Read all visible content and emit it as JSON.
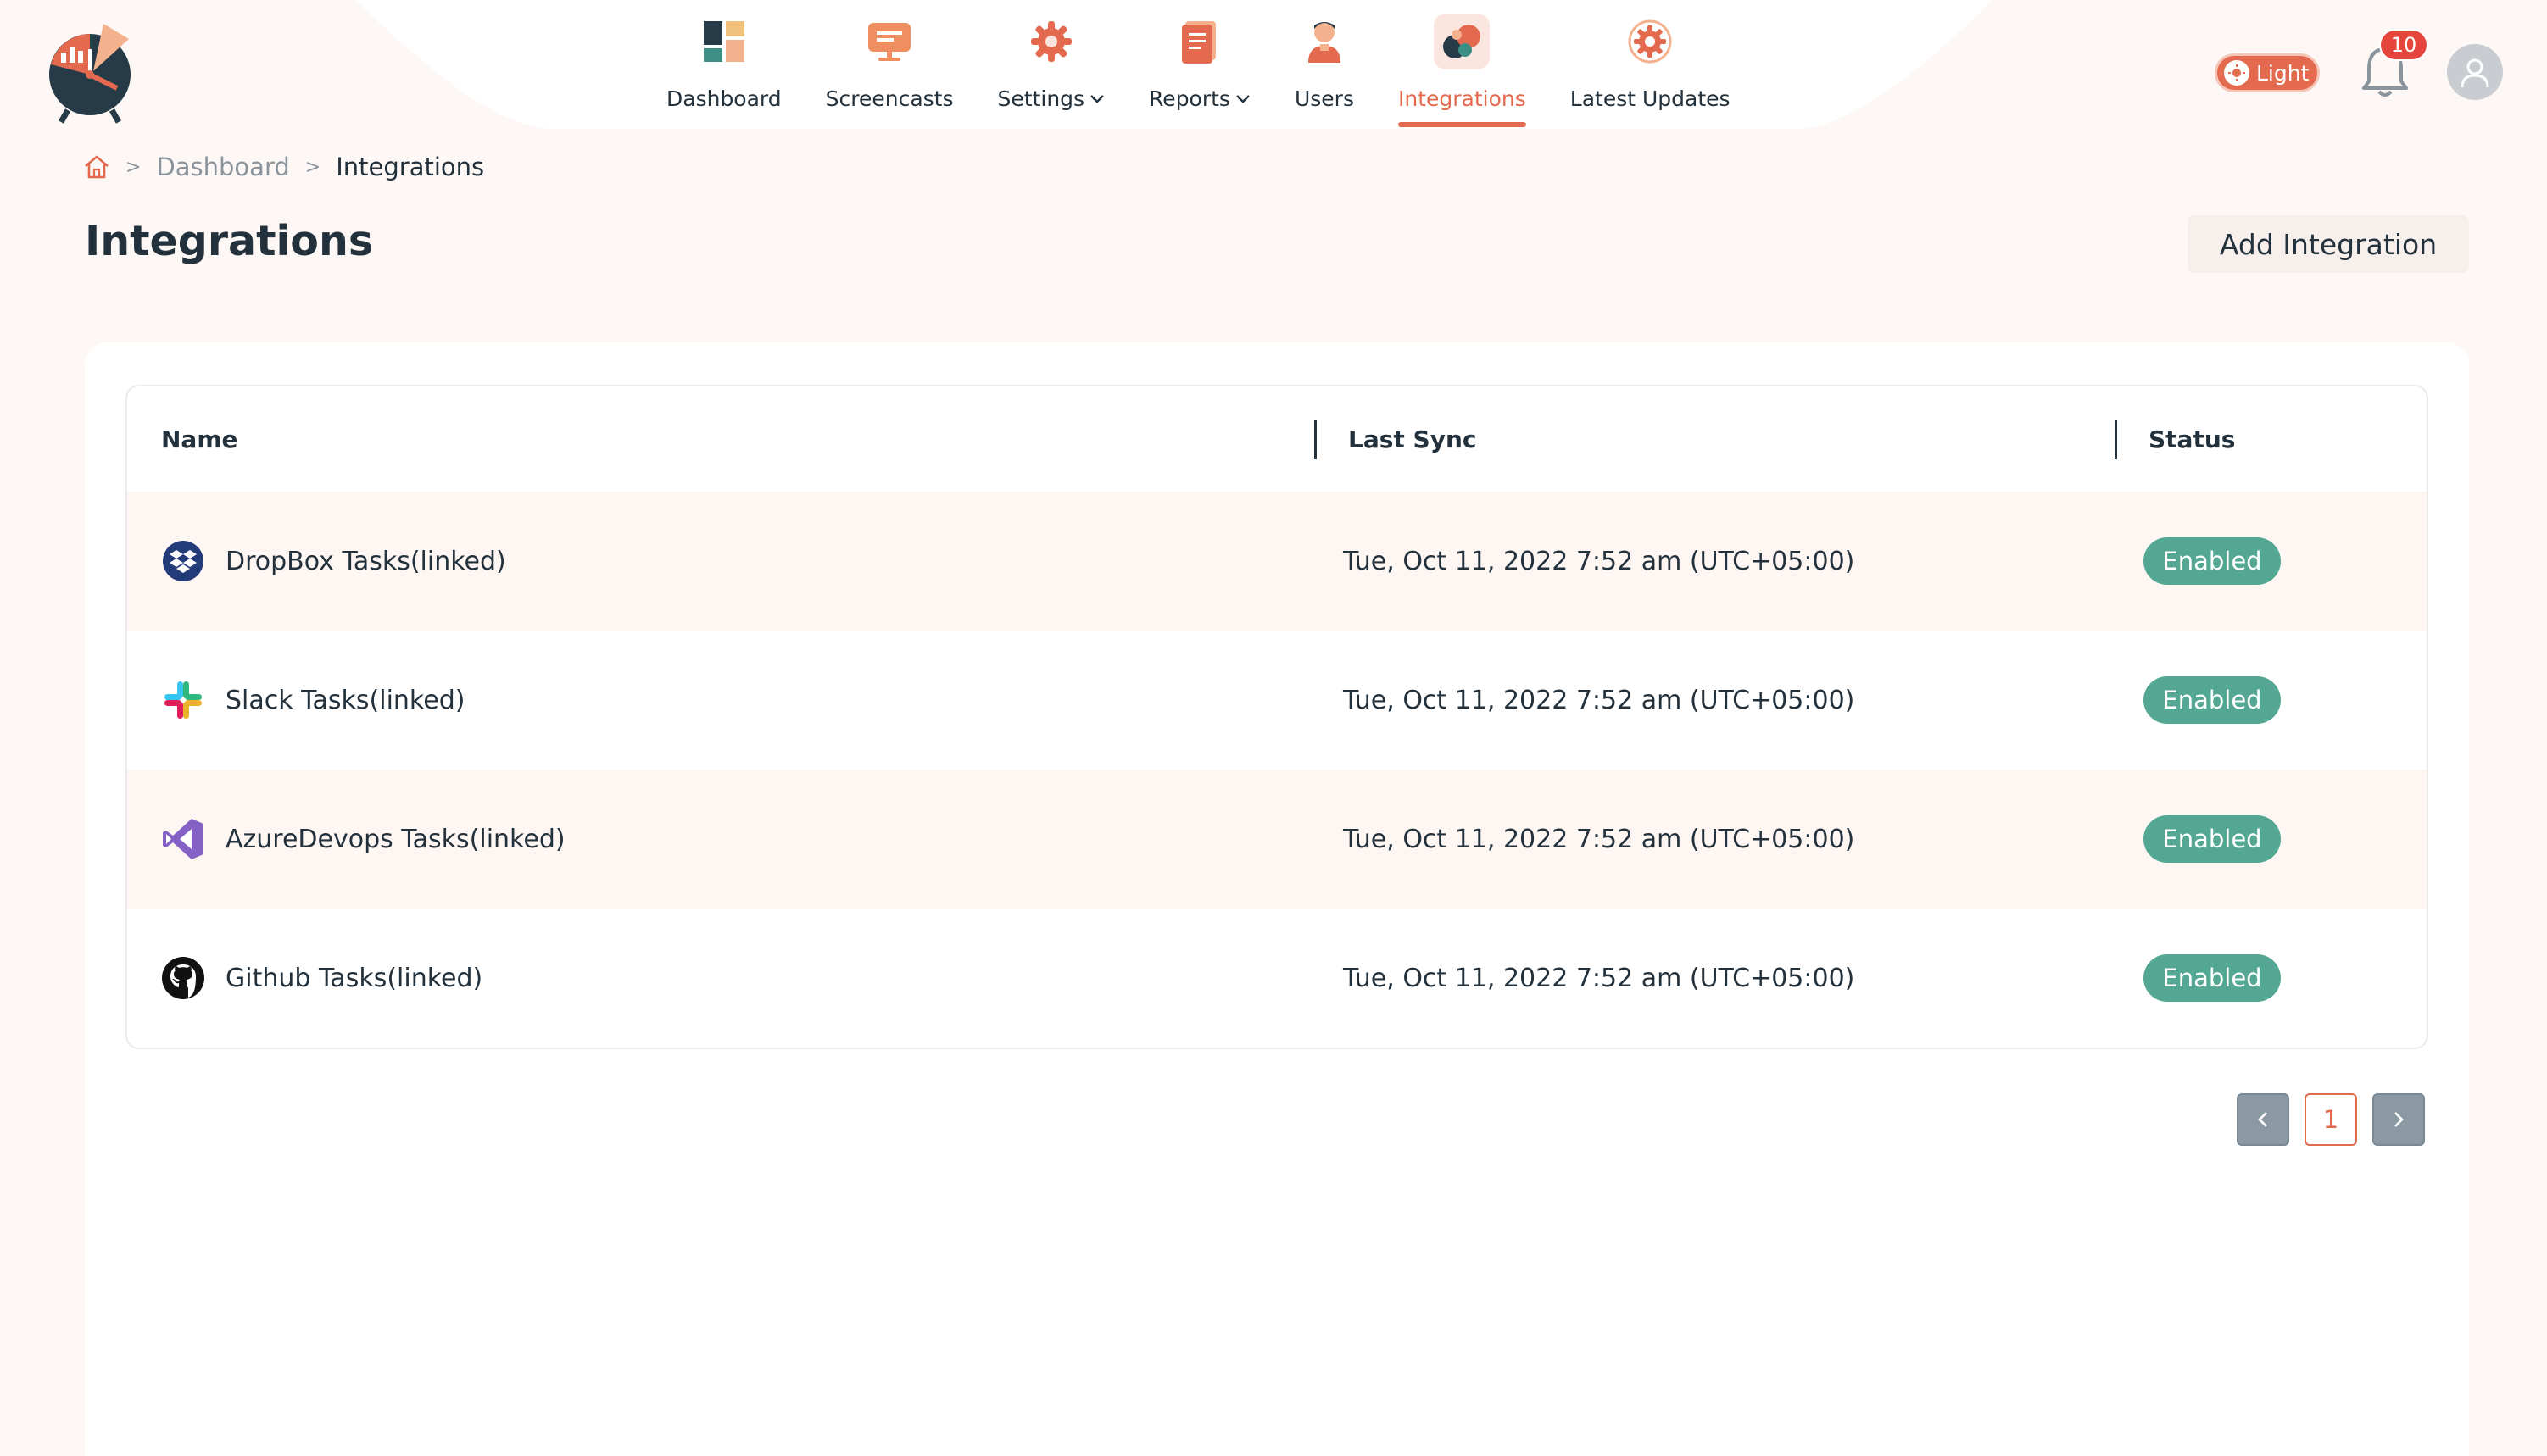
{
  "nav": {
    "items": [
      {
        "label": "Dashboard",
        "icon": "dashboard-icon",
        "dropdown": false,
        "active": false
      },
      {
        "label": "Screencasts",
        "icon": "screencast-icon",
        "dropdown": false,
        "active": false
      },
      {
        "label": "Settings",
        "icon": "gear-icon",
        "dropdown": true,
        "active": false
      },
      {
        "label": "Reports",
        "icon": "report-icon",
        "dropdown": true,
        "active": false
      },
      {
        "label": "Users",
        "icon": "user-icon",
        "dropdown": false,
        "active": false
      },
      {
        "label": "Integrations",
        "icon": "puzzle-icon",
        "dropdown": false,
        "active": true
      },
      {
        "label": "Latest Updates",
        "icon": "update-gear-icon",
        "dropdown": false,
        "active": false
      }
    ]
  },
  "header": {
    "theme_label": "Light",
    "notification_count": "10"
  },
  "breadcrumb": {
    "items": [
      "Dashboard"
    ],
    "current": "Integrations"
  },
  "page": {
    "title": "Integrations",
    "add_button": "Add Integration"
  },
  "table": {
    "headers": {
      "name": "Name",
      "last_sync": "Last Sync",
      "status": "Status"
    },
    "rows": [
      {
        "name": "DropBox Tasks(linked)",
        "icon": "dropbox-icon",
        "last_sync": "Tue, Oct 11, 2022 7:52 am (UTC+05:00)",
        "status": "Enabled"
      },
      {
        "name": "Slack Tasks(linked)",
        "icon": "slack-icon",
        "last_sync": "Tue, Oct 11, 2022 7:52 am (UTC+05:00)",
        "status": "Enabled"
      },
      {
        "name": "AzureDevops Tasks(linked)",
        "icon": "azure-devops-icon",
        "last_sync": "Tue, Oct 11, 2022 7:52 am (UTC+05:00)",
        "status": "Enabled"
      },
      {
        "name": "Github Tasks(linked)",
        "icon": "github-icon",
        "last_sync": "Tue, Oct 11, 2022 7:52 am (UTC+05:00)",
        "status": "Enabled"
      }
    ]
  },
  "pagination": {
    "current_page": "1"
  },
  "colors": {
    "accent": "#e36a4f",
    "status_enabled": "#54a893",
    "background": "#fdf8f5",
    "text": "#23313c"
  }
}
